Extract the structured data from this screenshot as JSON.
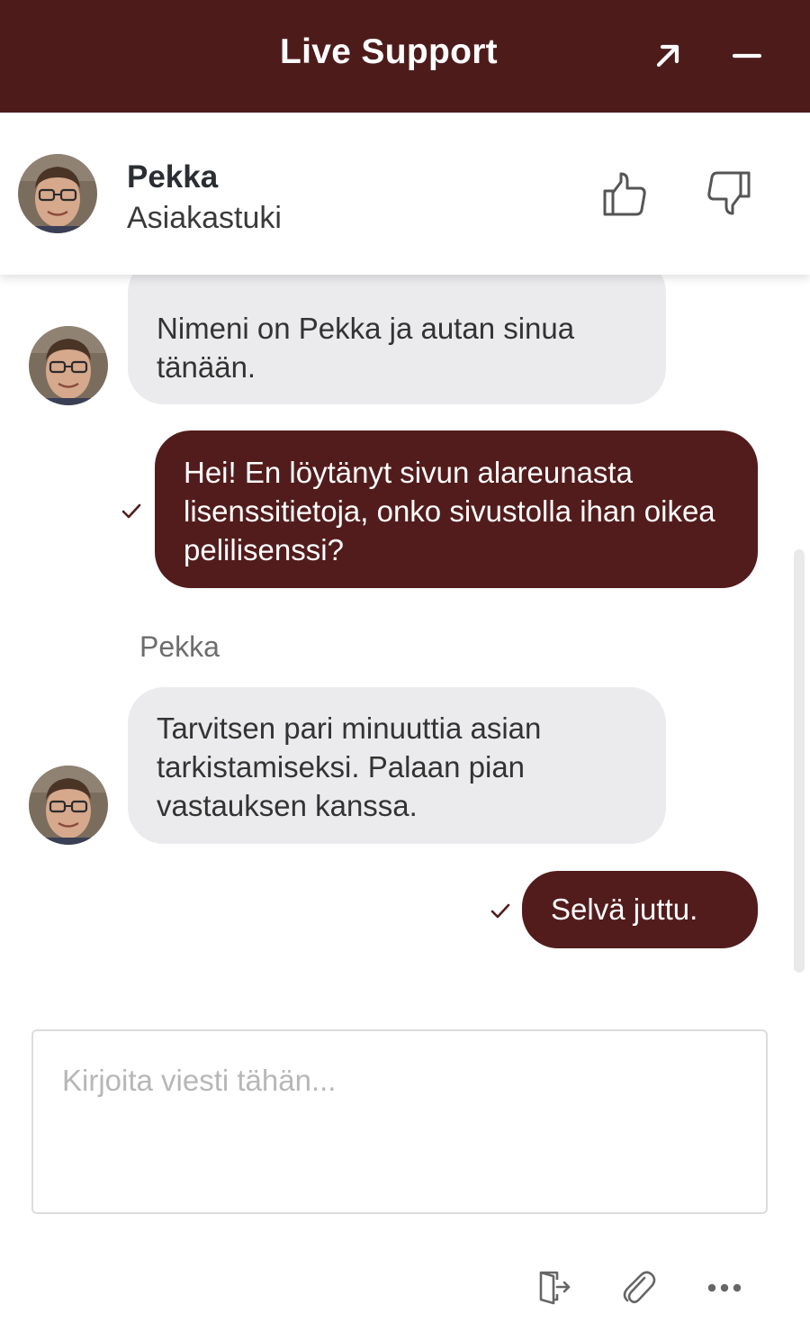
{
  "header": {
    "title": "Live Support",
    "background": "#4e1b1b",
    "popout_icon": "arrow-up-right-icon",
    "minimize_icon": "minus-icon"
  },
  "agent": {
    "name": "Pekka",
    "role": "Asiakastuki",
    "thumbs_up_icon": "thumbs-up-icon",
    "thumbs_down_icon": "thumbs-down-icon"
  },
  "messages": [
    {
      "from": "agent",
      "text": "Nimeni on Pekka ja autan sinua tänään."
    },
    {
      "from": "user",
      "text": "Hei! En löytänyt sivun alareunasta lisenssitietoja, onko sivustolla ihan oikea pelilisenssi?",
      "status_icon": "check-icon"
    },
    {
      "from": "agent",
      "sender": "Pekka",
      "text": "Tarvitsen pari minuuttia asian tarkistamiseksi. Palaan pian vastauksen kanssa."
    },
    {
      "from": "user",
      "text": "Selvä juttu.",
      "status_icon": "check-icon"
    }
  ],
  "composer": {
    "placeholder": "Kirjoita viesti tähän...",
    "value": ""
  },
  "toolbar": {
    "end_chat_icon": "exit-door-icon",
    "attach_icon": "paperclip-icon",
    "more_icon": "more-dots-icon"
  },
  "colors": {
    "accent": "#531c1c",
    "agent_bubble": "#ebebed",
    "agent_text": "#333333"
  }
}
